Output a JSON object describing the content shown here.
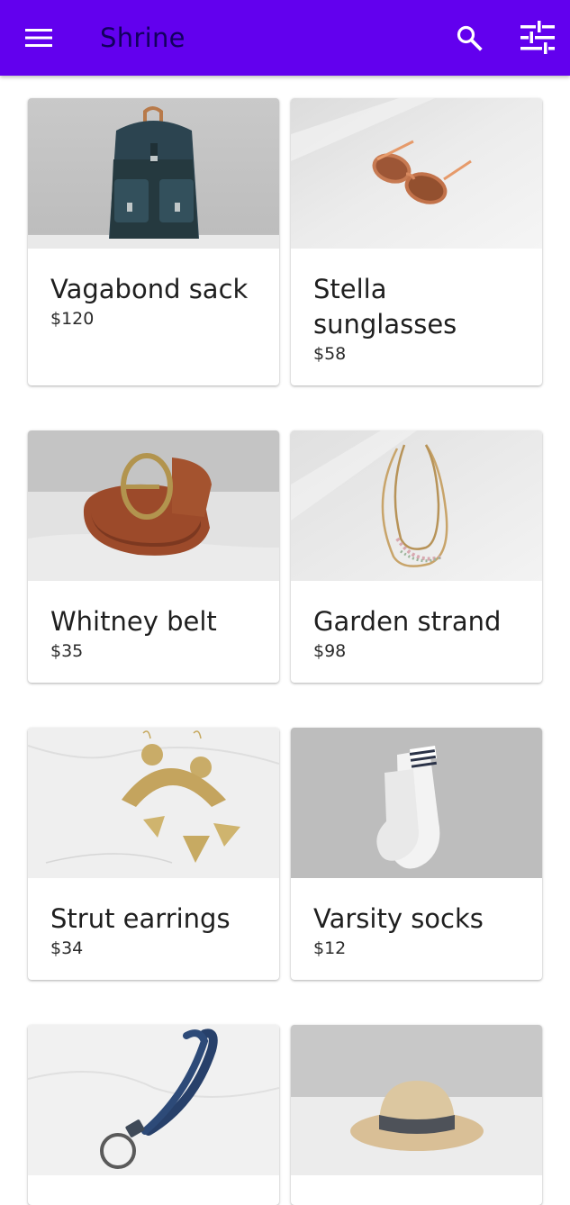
{
  "app_bar": {
    "title": "Shrine",
    "color": "#6200ee",
    "title_color": "#12005e",
    "menu_icon": "menu-icon",
    "search_icon": "search-icon",
    "filter_icon": "tune-icon"
  },
  "products": [
    {
      "name": "Vagabond sack",
      "price": "$120",
      "image": "backpack"
    },
    {
      "name": "Stella sunglasses",
      "price": "$58",
      "image": "sunglasses"
    },
    {
      "name": "Whitney belt",
      "price": "$35",
      "image": "belt"
    },
    {
      "name": "Garden strand",
      "price": "$98",
      "image": "necklace"
    },
    {
      "name": "Strut earrings",
      "price": "$34",
      "image": "earrings"
    },
    {
      "name": "Varsity socks",
      "price": "$12",
      "image": "socks"
    },
    {
      "name": "",
      "price": "",
      "image": "keyring"
    },
    {
      "name": "",
      "price": "",
      "image": "hat"
    }
  ]
}
